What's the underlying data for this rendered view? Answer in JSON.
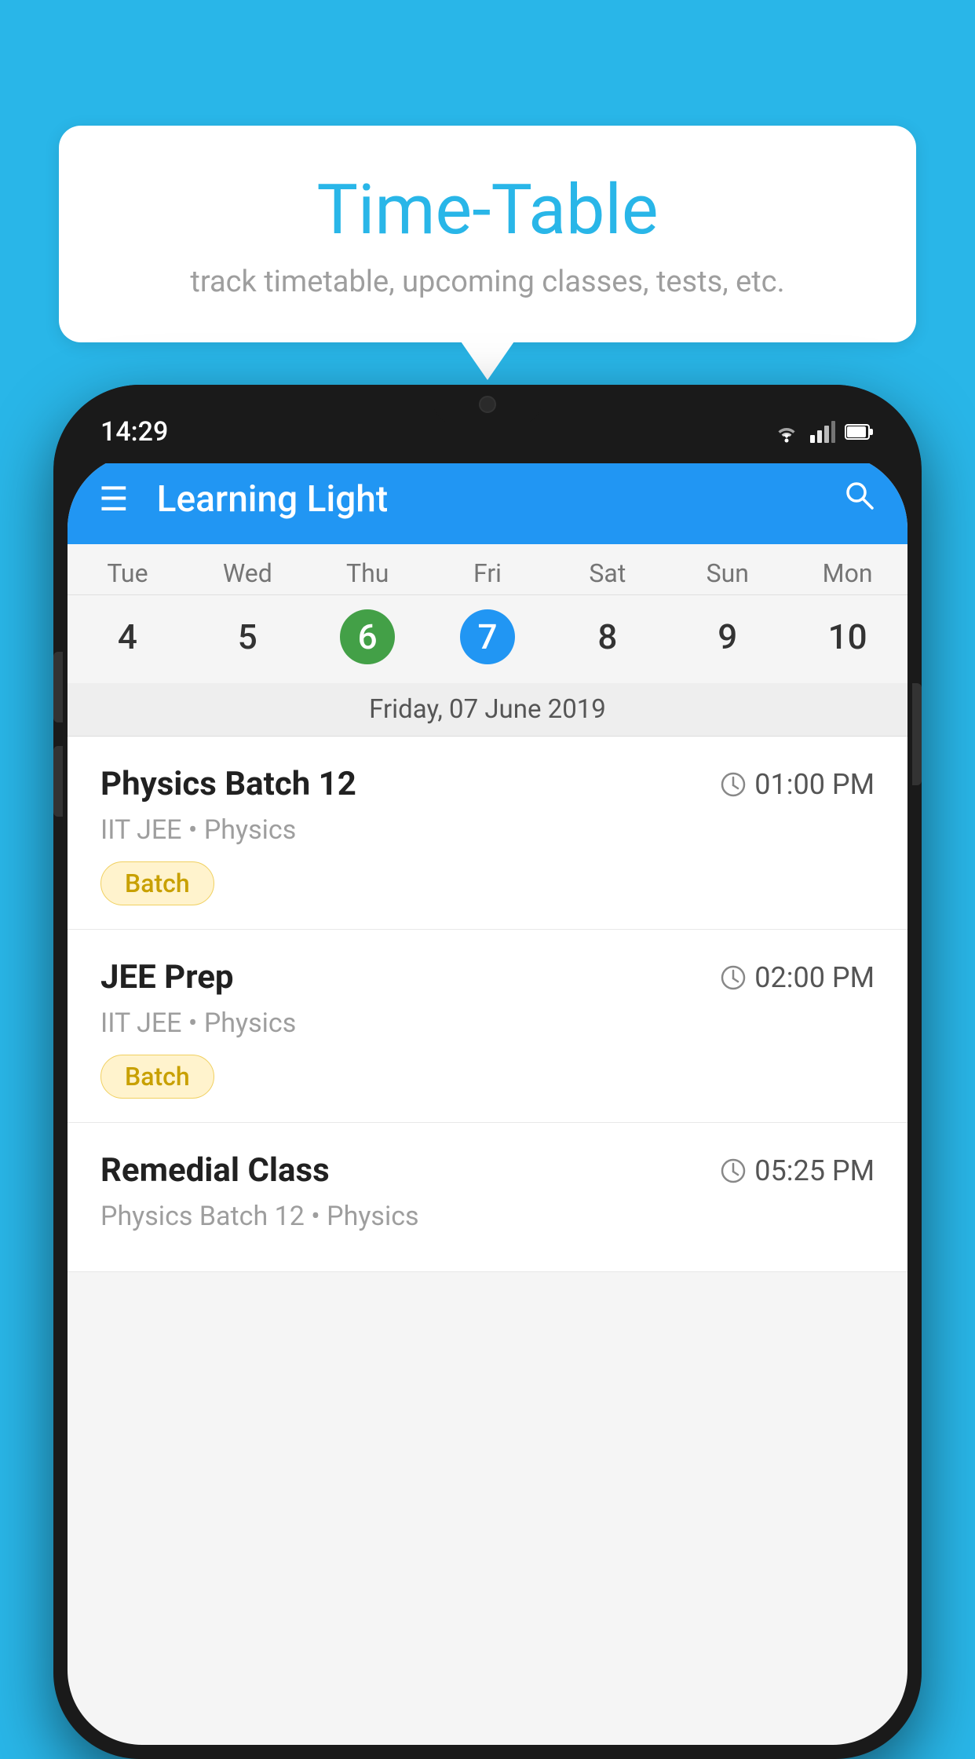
{
  "background_color": "#29b6e8",
  "speech_bubble": {
    "title": "Time-Table",
    "subtitle": "track timetable, upcoming classes, tests, etc."
  },
  "phone": {
    "status_bar": {
      "time": "14:29"
    },
    "app_header": {
      "title": "Learning Light"
    },
    "calendar": {
      "days_of_week": [
        "Tue",
        "Wed",
        "Thu",
        "Fri",
        "Sat",
        "Sun",
        "Mon"
      ],
      "day_numbers": [
        "4",
        "5",
        "6",
        "7",
        "8",
        "9",
        "10"
      ],
      "today_index": 2,
      "selected_index": 3,
      "selected_date_label": "Friday, 07 June 2019"
    },
    "classes": [
      {
        "name": "Physics Batch 12",
        "time": "01:00 PM",
        "meta": "IIT JEE • Physics",
        "badge": "Batch"
      },
      {
        "name": "JEE Prep",
        "time": "02:00 PM",
        "meta": "IIT JEE • Physics",
        "badge": "Batch"
      },
      {
        "name": "Remedial Class",
        "time": "05:25 PM",
        "meta": "Physics Batch 12 • Physics",
        "badge": null
      }
    ]
  }
}
